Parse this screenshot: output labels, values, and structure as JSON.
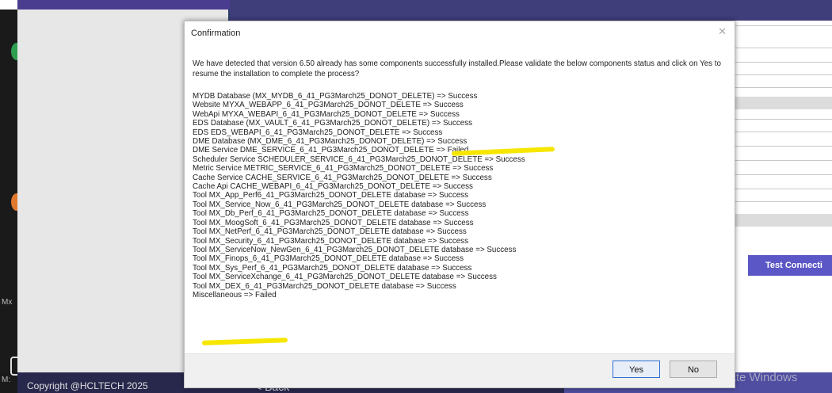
{
  "dialog": {
    "title": "Confirmation",
    "close_glyph": "✕",
    "message": "We have detected that version 6.50 already has some components successfully installed.Please validate the below components status and click on Yes to resume the installation to complete the process?",
    "status_lines": [
      "MYDB Database (MX_MYDB_6_41_PG3March25_DONOT_DELETE) => Success",
      "Website MYXA_WEBAPP_6_41_PG3March25_DONOT_DELETE => Success",
      "WebApi MYXA_WEBAPI_6_41_PG3March25_DONOT_DELETE => Success",
      "EDS Database (MX_VAULT_6_41_PG3March25_DONOT_DELETE) => Success",
      "EDS EDS_WEBAPI_6_41_PG3March25_DONOT_DELETE => Success",
      "DME Database (MX_DME_6_41_PG3March25_DONOT_DELETE) => Success",
      "DME Service DME_SERVICE_6_41_PG3March25_DONOT_DELETE => Failed",
      "Scheduler Service SCHEDULER_SERVICE_6_41_PG3March25_DONOT_DELETE => Success",
      "Metric Service METRIC_SERVICE_6_41_PG3March25_DONOT_DELETE => Success",
      "Cache Service CACHE_SERVICE_6_41_PG3March25_DONOT_DELETE => Success",
      "Cache Api CACHE_WEBAPI_6_41_PG3March25_DONOT_DELETE => Success",
      "Tool MX_App_Perf6_41_PG3March25_DONOT_DELETE database => Success",
      "Tool MX_Service_Now_6_41_PG3March25_DONOT_DELETE database => Success",
      "Tool MX_Db_Perf_6_41_PG3March25_DONOT_DELETE database => Success",
      "Tool MX_MoogSoft_6_41_PG3March25_DONOT_DELETE database => Success",
      "Tool MX_NetPerf_6_41_PG3March25_DONOT_DELETE database => Success",
      "Tool MX_Security_6_41_PG3March25_DONOT_DELETE database => Success",
      "Tool MX_ServiceNow_NewGen_6_41_PG3March25_DONOT_DELETE database => Success",
      "Tool MX_Finops_6_41_PG3March25_DONOT_DELETE database => Success",
      "Tool MX_Sys_Perf_6_41_PG3March25_DONOT_DELETE database => Success",
      "Tool MX_ServiceXchange_6_41_PG3March25_DONOT_DELETE database => Success",
      "Tool MX_DEX_6_41_PG3March25_DONOT_DELETE database => Success",
      "Miscellaneous => Failed"
    ],
    "yes_label": "Yes",
    "no_label": "No"
  },
  "background": {
    "test_connection_label": "Test Connecti",
    "copyright": "Copyright @HCLTECH 2025",
    "back_label": "< Back",
    "left_edge_label_1": "Mx",
    "left_edge_label_2": "M:",
    "activate_watermark": "Activate Windows"
  },
  "colors": {
    "highlight": "#f7e600",
    "primary_button": "#5b57c6",
    "header": "#3f3d7a"
  }
}
